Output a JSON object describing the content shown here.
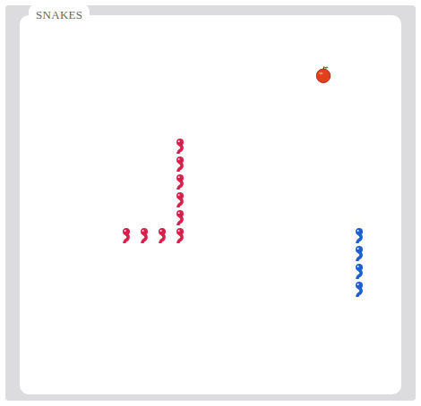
{
  "window": {
    "title": "SNAKES"
  },
  "apple": {
    "cell": [
      16,
      2
    ]
  },
  "snakes": [
    {
      "color": "#dc1f4a",
      "segments": [
        [
          8,
          6
        ],
        [
          8,
          7
        ],
        [
          8,
          8
        ],
        [
          8,
          9
        ],
        [
          8,
          10
        ],
        [
          8,
          11
        ],
        [
          7,
          11
        ],
        [
          6,
          11
        ],
        [
          5,
          11
        ]
      ]
    },
    {
      "color": "#1f5fd6",
      "segments": [
        [
          18,
          11
        ],
        [
          18,
          12
        ],
        [
          18,
          13
        ],
        [
          18,
          14
        ]
      ]
    }
  ]
}
